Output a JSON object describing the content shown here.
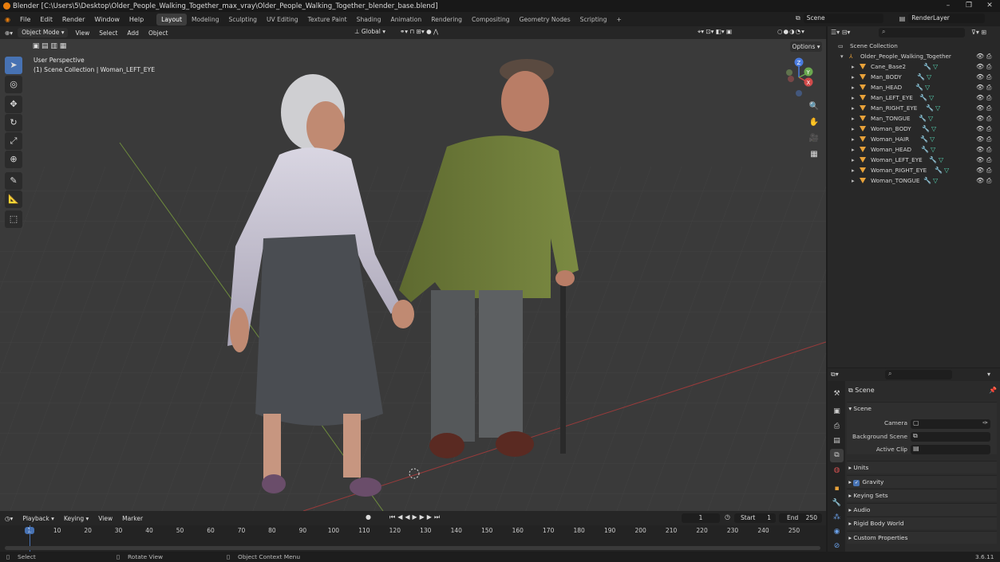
{
  "window": {
    "title": "Blender [C:\\Users\\5\\Desktop\\Older_People_Walking_Together_max_vray\\Older_People_Walking_Together_blender_base.blend]"
  },
  "menu": [
    "File",
    "Edit",
    "Render",
    "Window",
    "Help"
  ],
  "workspaces": [
    "Layout",
    "Modeling",
    "Sculpting",
    "UV Editing",
    "Texture Paint",
    "Shading",
    "Animation",
    "Rendering",
    "Compositing",
    "Geometry Nodes",
    "Scripting"
  ],
  "scene_field": "Scene",
  "renderlayer_field": "RenderLayer",
  "viewport_header": {
    "mode": "Object Mode",
    "menus": [
      "View",
      "Select",
      "Add",
      "Object"
    ],
    "orientation": "Global",
    "options": "Options"
  },
  "viewport_overlay": {
    "perspective": "User Perspective",
    "context": "(1) Scene Collection | Woman_LEFT_EYE"
  },
  "gizmo": {
    "x": "X",
    "y": "Y",
    "z": "Z"
  },
  "outliner": {
    "root": "Scene Collection",
    "collection": "Older_People_Walking_Together",
    "items": [
      "Cane_Base2",
      "Man_BODY",
      "Man_HEAD",
      "Man_LEFT_EYE",
      "Man_RIGHT_EYE",
      "Man_TONGUE",
      "Woman_BODY",
      "Woman_HAIR",
      "Woman_HEAD",
      "Woman_LEFT_EYE",
      "Woman_RIGHT_EYE",
      "Woman_TONGUE"
    ]
  },
  "properties": {
    "header": "Scene",
    "panel": "Scene",
    "camera_label": "Camera",
    "bg_label": "Background Scene",
    "clip_label": "Active Clip",
    "sections": [
      "Units",
      "Gravity",
      "Keying Sets",
      "Audio",
      "Rigid Body World",
      "Custom Properties"
    ]
  },
  "timeline": {
    "menus": [
      "Playback",
      "Keying",
      "View",
      "Marker"
    ],
    "current": "1",
    "start_label": "Start",
    "start": "1",
    "end_label": "End",
    "end": "250",
    "ticks": [
      "1",
      "10",
      "20",
      "30",
      "40",
      "50",
      "60",
      "70",
      "80",
      "90",
      "100",
      "110",
      "120",
      "130",
      "140",
      "150",
      "160",
      "170",
      "180",
      "190",
      "200",
      "210",
      "220",
      "230",
      "240",
      "250"
    ]
  },
  "status": {
    "select": "Select",
    "rotate": "Rotate View",
    "context": "Object Context Menu",
    "version": "3.6.11"
  }
}
